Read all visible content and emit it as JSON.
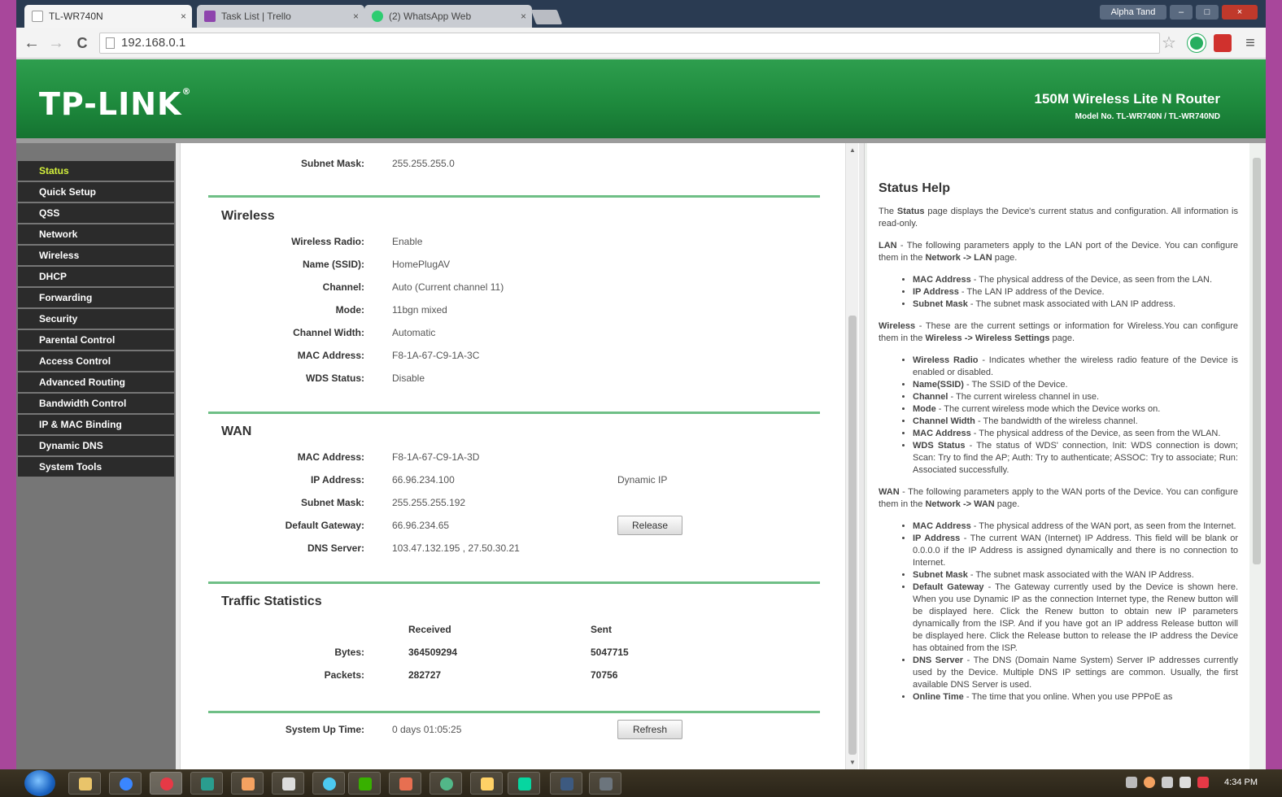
{
  "browser": {
    "tabs": [
      {
        "title": "TL-WR740N",
        "close": "×"
      },
      {
        "title": "Task List | Trello",
        "close": "×"
      },
      {
        "title": "(2) WhatsApp Web",
        "close": "×"
      }
    ],
    "user_label": "Alpha Tand",
    "address": "192.168.0.1",
    "back": "←",
    "forward": "→",
    "reload": "C",
    "star": "☆",
    "menu": "≡",
    "min": "–",
    "max": "□",
    "close": "×"
  },
  "router": {
    "logo": "TP-LINK",
    "logo_mark": "®",
    "product": "150M Wireless Lite N Router",
    "model": "Model No. TL-WR740N / TL-WR740ND"
  },
  "sidebar": {
    "items": [
      {
        "label": "Status"
      },
      {
        "label": "Quick Setup"
      },
      {
        "label": "QSS"
      },
      {
        "label": "Network"
      },
      {
        "label": "Wireless"
      },
      {
        "label": "DHCP"
      },
      {
        "label": "Forwarding"
      },
      {
        "label": "Security"
      },
      {
        "label": "Parental Control"
      },
      {
        "label": "Access Control"
      },
      {
        "label": "Advanced Routing"
      },
      {
        "label": "Bandwidth Control"
      },
      {
        "label": "IP & MAC Binding"
      },
      {
        "label": "Dynamic DNS"
      },
      {
        "label": "System Tools"
      }
    ]
  },
  "status": {
    "lan": {
      "subnet_label": "Subnet Mask:",
      "subnet_value": "255.255.255.0"
    },
    "wireless": {
      "title": "Wireless",
      "rows": [
        {
          "label": "Wireless Radio:",
          "value": "Enable"
        },
        {
          "label": "Name (SSID):",
          "value": "HomePlugAV"
        },
        {
          "label": "Channel:",
          "value": "Auto (Current channel 11)"
        },
        {
          "label": "Mode:",
          "value": "11bgn mixed"
        },
        {
          "label": "Channel Width:",
          "value": "Automatic"
        },
        {
          "label": "MAC Address:",
          "value": "F8-1A-67-C9-1A-3C"
        },
        {
          "label": "WDS Status:",
          "value": "Disable"
        }
      ]
    },
    "wan": {
      "title": "WAN",
      "rows": [
        {
          "label": "MAC Address:",
          "value": "F8-1A-67-C9-1A-3D"
        },
        {
          "label": "IP Address:",
          "value": "66.96.234.100"
        },
        {
          "label": "Subnet Mask:",
          "value": "255.255.255.192"
        },
        {
          "label": "Default Gateway:",
          "value": "66.96.234.65"
        },
        {
          "label": "DNS Server:",
          "value": "103.47.132.195 , 27.50.30.21"
        }
      ],
      "ip_type": "Dynamic IP",
      "release_button": "Release"
    },
    "traffic": {
      "title": "Traffic Statistics",
      "col_received": "Received",
      "col_sent": "Sent",
      "bytes_label": "Bytes:",
      "bytes_received": "364509294",
      "bytes_sent": "5047715",
      "packets_label": "Packets:",
      "packets_received": "282727",
      "packets_sent": "70756"
    },
    "uptime": {
      "label": "System Up Time:",
      "value": "0 days 01:05:25",
      "refresh_button": "Refresh"
    }
  },
  "help": {
    "title": "Status Help",
    "intro_a": "The ",
    "intro_b": "Status",
    "intro_c": " page displays the Device's current status and configuration. All information is read-only.",
    "lan_a": "LAN",
    "lan_b": " - The following parameters apply to the LAN port of the Device. You can configure them in the ",
    "lan_c": "Network -> LAN",
    "lan_d": " page.",
    "lan_items": [
      {
        "k": "MAC Address",
        "v": " - The physical address of the Device, as seen from the LAN."
      },
      {
        "k": "IP Address",
        "v": " - The LAN IP address of the Device."
      },
      {
        "k": "Subnet Mask",
        "v": " - The subnet mask associated with LAN IP address."
      }
    ],
    "wl_a": "Wireless",
    "wl_b": " - These are the current settings or information for Wireless.You can configure them in the ",
    "wl_c": "Wireless -> Wireless Settings",
    "wl_d": " page.",
    "wl_items": [
      {
        "k": "Wireless Radio",
        "v": " - Indicates whether the wireless radio feature of the Device is enabled or disabled."
      },
      {
        "k": "Name(SSID)",
        "v": " - The SSID of the Device."
      },
      {
        "k": "Channel",
        "v": " - The current wireless channel in use."
      },
      {
        "k": "Mode",
        "v": " - The current wireless mode which the Device works on."
      },
      {
        "k": "Channel Width",
        "v": " - The bandwidth of the wireless channel."
      },
      {
        "k": "MAC Address",
        "v": " - The physical address of the Device, as seen from the WLAN."
      },
      {
        "k": "WDS Status",
        "v": " - The status of WDS' connection, Init: WDS connection is down; Scan: Try to find the AP; Auth: Try to authenticate; ASSOC: Try to associate; Run: Associated successfully."
      }
    ],
    "wan_a": "WAN",
    "wan_b": " - The following parameters apply to the WAN ports of the Device. You can configure them in the ",
    "wan_c": "Network -> WAN",
    "wan_d": " page.",
    "wan_items": [
      {
        "k": "MAC Address",
        "v": " - The physical address of the WAN port, as seen from the Internet."
      },
      {
        "k": "IP Address",
        "v": " - The current WAN (Internet) IP Address. This field will be blank or 0.0.0.0 if the IP Address is assigned dynamically and there is no connection to Internet."
      },
      {
        "k": "Subnet Mask",
        "v": " - The subnet mask associated with the WAN IP Address."
      },
      {
        "k": "Default Gateway",
        "v": " - The Gateway currently used by the Device is shown here. When you use Dynamic IP as the connection Internet type, the Renew button will be displayed here. Click the Renew button to obtain new IP parameters dynamically from the ISP. And if you have got an IP address Release button will be displayed here. Click the Release button to release the IP address the Device has obtained from the ISP."
      },
      {
        "k": "DNS Server",
        "v": " - The DNS (Domain Name System) Server IP addresses currently used by the Device. Multiple DNS IP settings are common. Usually, the first available DNS Server is used."
      },
      {
        "k": "Online Time",
        "v": " - The time that you online. When you use PPPoE as"
      }
    ]
  },
  "taskbar": {
    "clock": "4:34 PM"
  },
  "colors": {
    "banner_green": "#1e8a3d",
    "menu_active": "#d3f03c",
    "separator": "#6fbf86",
    "frame_purple": "#a8479b"
  }
}
